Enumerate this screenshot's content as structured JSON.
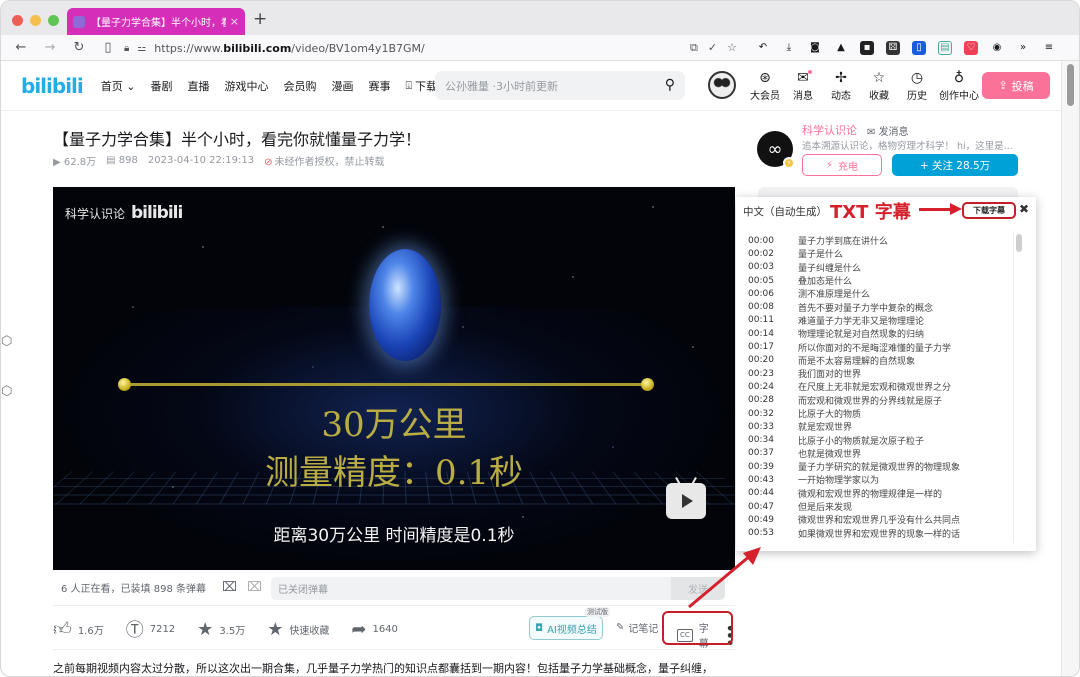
{
  "browser": {
    "tab_title": "【量子力学合集】半个小时，看完你",
    "tab_close": "×",
    "new_tab": "+",
    "url_prefix": "https://www.",
    "url_domain": "bilibili.com",
    "url_path": "/video/BV1om4y1B7GM/",
    "traffic_colors": [
      "#ec5f57",
      "#f4bf4f",
      "#5fc454"
    ],
    "nav": {
      "back": "←",
      "forward": "→",
      "reload": "↻",
      "reader": "▯"
    },
    "extensions": [
      "undo-icon",
      "download-icon",
      "camera-icon",
      "rocket-icon",
      "ghost-icon",
      "dice-icon",
      "bitwarden-icon",
      "save-icon",
      "pocket-icon",
      "panda-icon"
    ],
    "overflow": "»",
    "menu": "≡"
  },
  "site": {
    "logo": "bilibili",
    "menu": [
      "首页",
      "番剧",
      "直播",
      "游戏中心",
      "会员购",
      "漫画",
      "赛事"
    ],
    "download_client": "下载客户端",
    "search_placeholder": "公孙雅量 ·3小时前更新",
    "header_icons": [
      {
        "label": "大会员",
        "icon": "vip-icon",
        "glyph": "⊛"
      },
      {
        "label": "消息",
        "icon": "mail-icon",
        "glyph": "✉"
      },
      {
        "label": "动态",
        "icon": "pinwheel-icon",
        "glyph": "✢"
      },
      {
        "label": "收藏",
        "icon": "star-icon",
        "glyph": "☆"
      },
      {
        "label": "历史",
        "icon": "clock-icon",
        "glyph": "◷"
      },
      {
        "label": "创作中心",
        "icon": "bulb-icon",
        "glyph": "♁"
      }
    ],
    "upload_label": "投稿",
    "brand_color": "#fb7299",
    "accent_color": "#00a1d6"
  },
  "video": {
    "title": "【量子力学合集】半个小时，看完你就懂量子力学！",
    "views": "62.8万",
    "danmaku_count": "898",
    "date": "2023-04-10 22:19:13",
    "copyright": "未经作者授权，禁止转载",
    "watermark_channel": "科学认识论",
    "watermark_logo": "bilibili",
    "frame_line1": "30万公里",
    "frame_line2": "测量精度：0.1秒",
    "subtitle_text": "距离30万公里 时间精度是0.1秒"
  },
  "uploader": {
    "name": "科学认识论",
    "message": "发消息",
    "description": "追本溯源认识论，格物穷理才科学！ hi，这里是...",
    "charge": "充电",
    "follow": "+ 关注 28.5万"
  },
  "danmaku_bar": {
    "info": "6 人正在看，已装填 898 条弹幕",
    "input_placeholder": "已关闭弹幕",
    "send": "发送"
  },
  "actions": {
    "like": "1.6万",
    "coin": "7212",
    "favorite": "3.5万",
    "quick_fav": "快速收藏",
    "share": "1640",
    "ai_summary": "AI视频总结",
    "ai_tag": "测试版",
    "note": "记笔记",
    "subtitle": "字幕",
    "cc": "CC"
  },
  "description": "之前每期视频内容太过分散，所以这次出一期合集，几乎量子力学热门的知识点都囊括到一期内容！包括量子力学基础概念，量子纠缠，",
  "subtitle_panel": {
    "language": "中文（自动生成）",
    "annotation": "TXT 字幕",
    "download": "下载字幕",
    "close": "✖",
    "rows": [
      {
        "time": "00:00",
        "text": "量子力学到底在讲什么"
      },
      {
        "time": "00:02",
        "text": "量子是什么"
      },
      {
        "time": "00:03",
        "text": "量子纠缠是什么"
      },
      {
        "time": "00:05",
        "text": "叠加态是什么"
      },
      {
        "time": "00:06",
        "text": "测不准原理是什么"
      },
      {
        "time": "00:08",
        "text": "首先不要对量子力学中复杂的概念"
      },
      {
        "time": "00:11",
        "text": "难道量子力学无非又是物理理论"
      },
      {
        "time": "00:14",
        "text": "物理理论就是对自然现象的归纳"
      },
      {
        "time": "00:17",
        "text": "所以你面对的不是晦涩难懂的量子力学"
      },
      {
        "time": "00:20",
        "text": "而是不太容易理解的自然现象"
      },
      {
        "time": "00:23",
        "text": "我们面对的世界"
      },
      {
        "time": "00:24",
        "text": "在尺度上无非就是宏观和微观世界之分"
      },
      {
        "time": "00:28",
        "text": "而宏观和微观世界的分界线就是原子"
      },
      {
        "time": "00:32",
        "text": "比原子大的物质"
      },
      {
        "time": "00:33",
        "text": "就是宏观世界"
      },
      {
        "time": "00:34",
        "text": "比原子小的物质就是次原子粒子"
      },
      {
        "time": "00:37",
        "text": "也就是微观世界"
      },
      {
        "time": "00:39",
        "text": "量子力学研究的就是微观世界的物理现象"
      },
      {
        "time": "00:43",
        "text": "一开始物理学家以为"
      },
      {
        "time": "00:44",
        "text": "微观和宏观世界的物理规律是一样的"
      },
      {
        "time": "00:47",
        "text": "但是后来发现"
      },
      {
        "time": "00:49",
        "text": "微观世界和宏观世界几乎没有什么共同点"
      },
      {
        "time": "00:53",
        "text": "如果微观世界和宏观世界的现象一样的话"
      }
    ]
  }
}
